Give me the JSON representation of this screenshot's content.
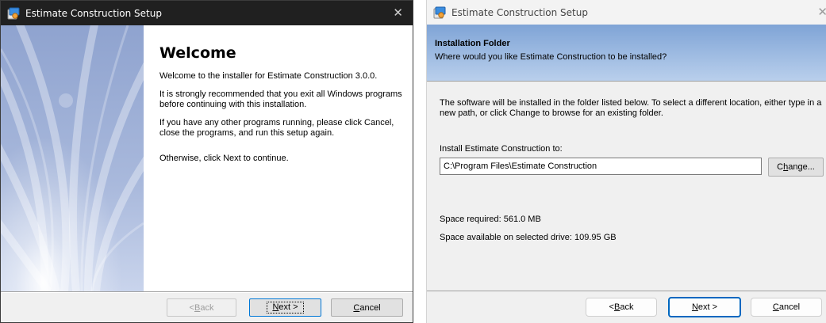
{
  "welcome_window": {
    "title": "Estimate Construction Setup",
    "heading": "Welcome",
    "paragraphs": [
      "Welcome to the installer for Estimate Construction 3.0.0.",
      "It is strongly recommended that you exit all Windows programs before continuing with this installation.",
      "If you have any other programs running, please click Cancel, close the programs, and run this setup again.",
      "Otherwise, click Next to continue."
    ],
    "buttons": {
      "back": {
        "accel": "B",
        "rest": "ack",
        "prefix": "< ",
        "enabled": false
      },
      "next": {
        "accel": "N",
        "rest": "ext >",
        "prefix": ""
      },
      "cancel": {
        "accel": "C",
        "rest": "ancel",
        "prefix": ""
      }
    }
  },
  "folder_window": {
    "title": "Estimate Construction Setup",
    "header_title": "Installation Folder",
    "header_subtitle": "Where would you like Estimate Construction to be installed?",
    "description": "The software will be installed in the folder listed below. To select a different location, either type in a new path, or click Change to browse for an existing folder.",
    "install_label": "Install Estimate Construction to:",
    "install_path": "C:\\Program Files\\Estimate Construction",
    "change_button": {
      "prefix": "C",
      "accel": "h",
      "rest": "ange..."
    },
    "space_required": "Space required: 561.0 MB",
    "space_available": "Space available on selected drive: 109.95 GB",
    "buttons": {
      "back": {
        "accel": "B",
        "rest": "ack",
        "prefix": "< "
      },
      "next": {
        "accel": "N",
        "rest": "ext >",
        "prefix": ""
      },
      "cancel": {
        "accel": "C",
        "rest": "ancel",
        "prefix": ""
      }
    }
  },
  "icons": {
    "app": "setup-app-icon",
    "close": "close-icon"
  },
  "colors": {
    "dark_titlebar": "#202020",
    "header_band_top": "#7fa4d6",
    "header_band_bottom": "#b9cfec",
    "side_panel": "#a5b6da",
    "primary_button_border": "#0067c0"
  }
}
